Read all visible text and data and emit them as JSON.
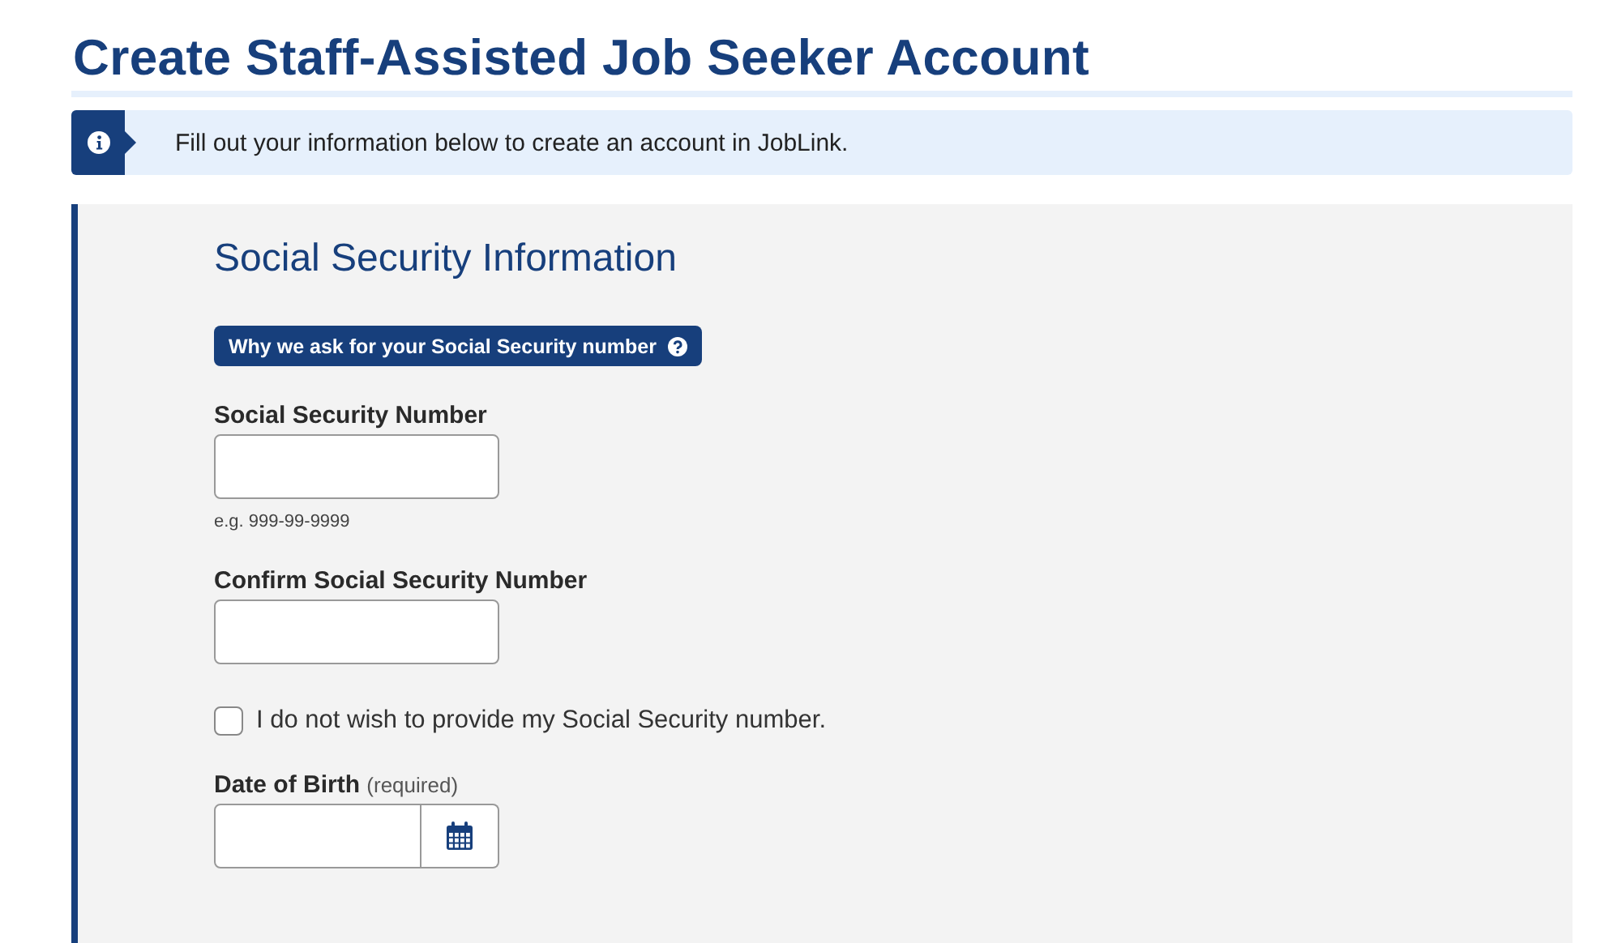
{
  "page_title": "Create Staff-Assisted Job Seeker Account",
  "alert": {
    "text": "Fill out your information below to create an account in JobLink."
  },
  "section": {
    "heading": "Social Security Information",
    "help_button": "Why we ask for your Social Security number",
    "fields": [
      {
        "kind": "text",
        "label": "Social Security Number",
        "hint": "e.g. 999-99-9999"
      },
      {
        "kind": "text",
        "label": "Confirm Social Security Number"
      },
      {
        "kind": "checkbox",
        "label": "I do not wish to provide my Social Security number.",
        "checked": false
      },
      {
        "kind": "date",
        "label": "Date of Birth",
        "note": "(required)"
      }
    ]
  }
}
